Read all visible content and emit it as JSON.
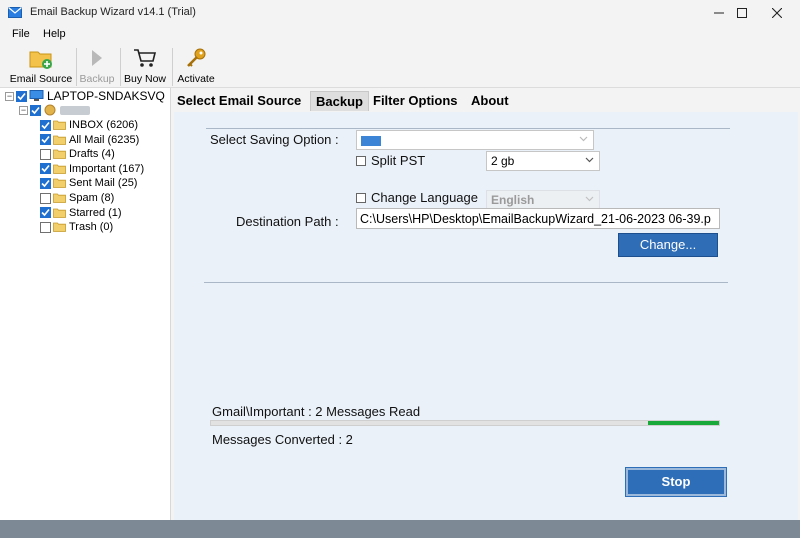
{
  "window": {
    "title": "Email Backup Wizard v14.1 (Trial)",
    "controls": [
      "minimize",
      "maximize",
      "close"
    ]
  },
  "menu": [
    "File",
    "Help"
  ],
  "toolbar": [
    {
      "label": "Email Source",
      "icon": "folder-add-icon",
      "enabled": true
    },
    {
      "label": "Backup",
      "icon": "play-icon",
      "enabled": false
    },
    {
      "label": "Buy Now",
      "icon": "cart-icon",
      "enabled": true
    },
    {
      "label": "Activate",
      "icon": "key-icon",
      "enabled": true
    }
  ],
  "tree": {
    "root": "LAPTOP-SNDAKSVQ",
    "account": "",
    "folders": [
      {
        "label": "INBOX (6206)",
        "checked": true
      },
      {
        "label": "All Mail (6235)",
        "checked": true
      },
      {
        "label": "Drafts (4)",
        "checked": false
      },
      {
        "label": "Important (167)",
        "checked": true
      },
      {
        "label": "Sent Mail (25)",
        "checked": true
      },
      {
        "label": "Spam (8)",
        "checked": false
      },
      {
        "label": "Starred (1)",
        "checked": true
      },
      {
        "label": "Trash (0)",
        "checked": false
      }
    ]
  },
  "tabs": [
    {
      "label": "Select Email Source",
      "active": false
    },
    {
      "label": "Backup",
      "active": true
    },
    {
      "label": "Filter Options",
      "active": false
    },
    {
      "label": "About",
      "active": false
    }
  ],
  "backup": {
    "saving_option_label": "Select Saving Option :",
    "saving_option_value": "",
    "split_pst_label": "Split PST",
    "split_pst_checked": false,
    "split_size": "2 gb",
    "change_language_label": "Change Language",
    "change_language_checked": false,
    "language": "English",
    "destination_label": "Destination Path :",
    "destination_path": "C:\\Users\\HP\\Desktop\\EmailBackupWizard_21-06-2023 06-39.p",
    "change_button": "Change...",
    "status_text": "Gmail\\Important : 2 Messages Read",
    "progress_fraction": 0.14,
    "converted_text": "Messages Converted : 2",
    "stop_button": "Stop"
  },
  "colors": {
    "accent": "#2e6db7",
    "progress": "#19a83a",
    "panel": "#eaf1f9",
    "checkbox": "#1f6fd1"
  }
}
